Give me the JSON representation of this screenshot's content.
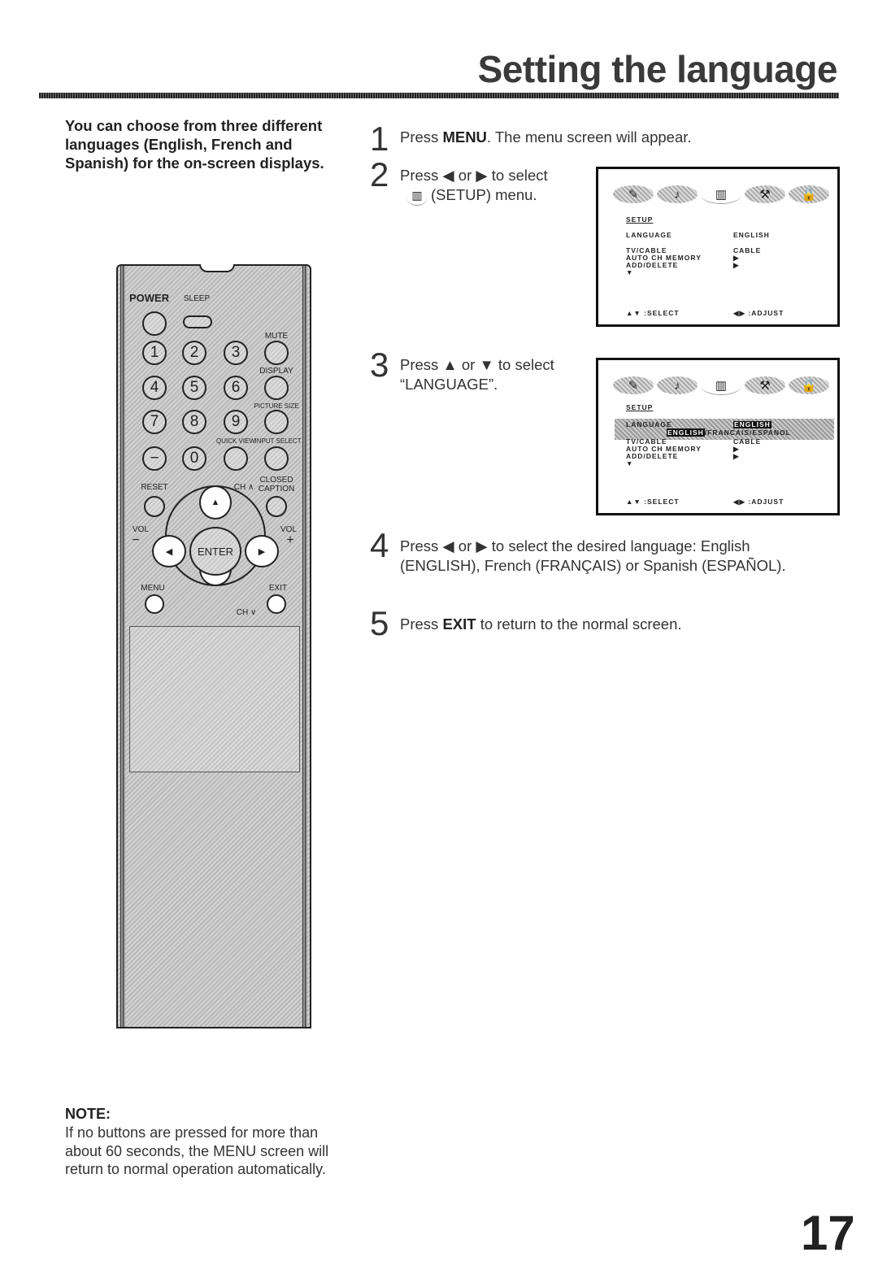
{
  "page": {
    "title": "Setting the language",
    "page_number": "17",
    "intro": "You can choose from three different languages (English, French and Spanish) for the on-screen displays."
  },
  "steps": [
    {
      "number": "1",
      "pre": "Press ",
      "bold": "MENU",
      "post": ". The menu screen will appear."
    },
    {
      "number": "2",
      "line1": "Press ◀ or ▶ to select",
      "line2": "(SETUP) menu."
    },
    {
      "number": "3",
      "line1": "Press ▲ or ▼ to select",
      "line2": "“LANGUAGE”."
    },
    {
      "number": "4",
      "line1": "Press ◀ or ▶ to select the desired language: English",
      "line2": "(ENGLISH), French (FRANÇAIS) or Spanish (ESPAÑOL)."
    },
    {
      "number": "5",
      "pre": "Press ",
      "bold": "EXIT",
      "post": " to return to the normal screen."
    }
  ],
  "screen1": {
    "icons": [
      "paintbrush-icon",
      "music-note-icon",
      "setup-box-icon",
      "tools-icon",
      "lock-icon"
    ],
    "heading": "SETUP",
    "rows": [
      {
        "label": "LANGUAGE",
        "value": "ENGLISH"
      },
      {
        "label": "TV/CABLE",
        "value": "CABLE"
      },
      {
        "label": "AUTO CH MEMORY",
        "value": "▶"
      },
      {
        "label": "ADD/DELETE",
        "value": "▶"
      }
    ],
    "more": "▼",
    "footer_left": "▲▼ :SELECT",
    "footer_right": "◀▶ :ADJUST"
  },
  "screen2": {
    "heading": "SETUP",
    "language_label": "LANGUAGE",
    "language_value": "ENGLISH",
    "options": [
      "ENGLISH",
      "/FRANCAIS/ESPANOL"
    ],
    "rows": [
      {
        "label": "TV/CABLE",
        "value": "CABLE"
      },
      {
        "label": "AUTO CH MEMORY",
        "value": "▶"
      },
      {
        "label": "ADD/DELETE",
        "value": "▶"
      }
    ],
    "more": "▼",
    "footer_left": "▲▼ :SELECT",
    "footer_right": "◀▶ :ADJUST"
  },
  "remote": {
    "power": "POWER",
    "sleep": "SLEEP",
    "mute": "MUTE",
    "display": "DISPLAY",
    "picture_size": "PICTURE SIZE",
    "quick_view": "QUICK VIEW",
    "input_select": "INPUT SELECT",
    "reset": "RESET",
    "ch_up": "CH ∧",
    "closed": "CLOSED",
    "caption": "CAPTION",
    "vol": "VOL",
    "minus": "−",
    "plus": "+",
    "enter": "ENTER",
    "menu": "MENU",
    "exit": "EXIT",
    "ch_down": "CH ∨",
    "digits": [
      "1",
      "2",
      "3",
      "4",
      "5",
      "6",
      "7",
      "8",
      "9",
      "−",
      "0"
    ],
    "up": "▲",
    "down": "▼",
    "left": "◀",
    "right": "▶"
  },
  "note": {
    "heading": "NOTE:",
    "text": "If no buttons are pressed for more than about 60 seconds, the MENU screen will return to normal operation automatically."
  }
}
